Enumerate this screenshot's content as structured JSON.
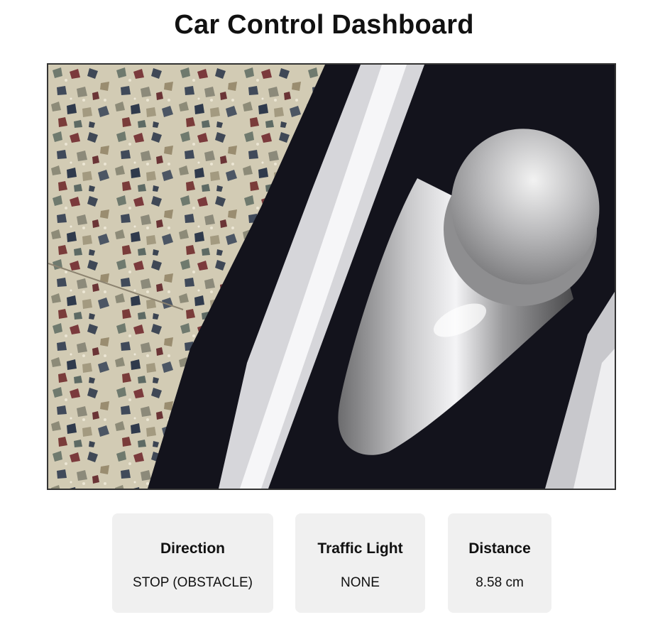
{
  "page": {
    "title": "Car Control Dashboard"
  },
  "camera": {
    "icon": "camera-feed",
    "scene": "terrazzo floor, black mat with silver tape, metal bollard"
  },
  "status": {
    "direction": {
      "label": "Direction",
      "value": "STOP (OBSTACLE)"
    },
    "traffic_light": {
      "label": "Traffic Light",
      "value": "NONE"
    },
    "distance": {
      "label": "Distance",
      "value": "8.58 cm"
    }
  },
  "colors": {
    "card_bg": "#f0f0f0",
    "frame_border": "#333333",
    "text": "#111111"
  }
}
